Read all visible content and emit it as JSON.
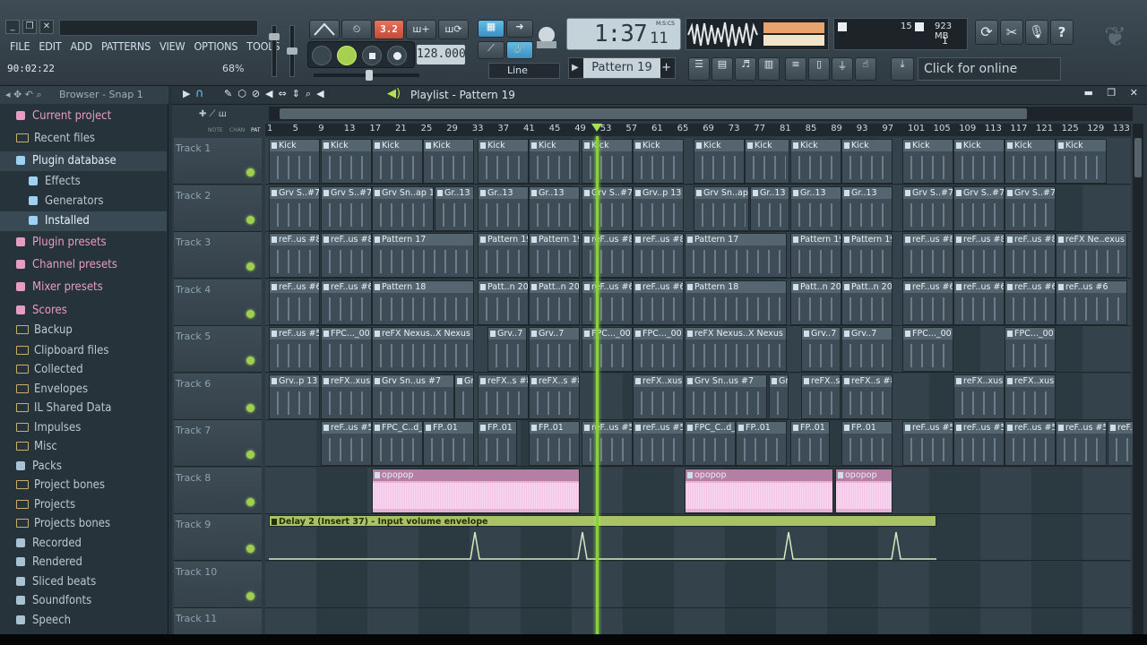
{
  "menu": [
    "FILE",
    "EDIT",
    "ADD",
    "PATTERNS",
    "VIEW",
    "OPTIONS",
    "TOOLS",
    "?"
  ],
  "status": {
    "time": "90:02:22",
    "zoom": "68%"
  },
  "toolbar": {
    "pattern_num": "3.2",
    "bpm": "128.000",
    "snap_mode": "Line",
    "song_time": "1:37",
    "song_time_small": "11",
    "song_time_unit": "M:S:CS",
    "pattern_name": "Pattern 19",
    "cpu_voices": "15",
    "memory": "923 MB",
    "cpu_count": "1",
    "online_news": "Click for online news"
  },
  "browser": {
    "header": "Browser - Snap 1",
    "items": [
      {
        "label": "Current project",
        "icon": "project-icon"
      },
      {
        "label": "Recent files",
        "icon": "folder-icon"
      },
      {
        "label": "Plugin database",
        "icon": "plugin-icon"
      },
      {
        "label": "Effects",
        "icon": "effect-icon"
      },
      {
        "label": "Generators",
        "icon": "generator-icon"
      },
      {
        "label": "Installed",
        "icon": "installed-icon"
      },
      {
        "label": "Plugin presets",
        "icon": "preset-icon"
      },
      {
        "label": "Channel presets",
        "icon": "preset-icon"
      },
      {
        "label": "Mixer presets",
        "icon": "mixer-icon"
      },
      {
        "label": "Scores",
        "icon": "note-icon"
      },
      {
        "label": "Backup",
        "icon": "folder-icon"
      },
      {
        "label": "Clipboard files",
        "icon": "folder-icon"
      },
      {
        "label": "Collected",
        "icon": "folder-icon"
      },
      {
        "label": "Envelopes",
        "icon": "folder-icon"
      },
      {
        "label": "IL Shared Data",
        "icon": "folder-icon"
      },
      {
        "label": "Impulses",
        "icon": "folder-icon"
      },
      {
        "label": "Misc",
        "icon": "folder-icon"
      },
      {
        "label": "Packs",
        "icon": "packs-icon"
      },
      {
        "label": "Project bones",
        "icon": "folder-icon"
      },
      {
        "label": "Projects",
        "icon": "folder-icon"
      },
      {
        "label": "Projects bones",
        "icon": "folder-icon"
      },
      {
        "label": "Recorded",
        "icon": "recorded-icon"
      },
      {
        "label": "Rendered",
        "icon": "rendered-icon"
      },
      {
        "label": "Sliced beats",
        "icon": "sliced-icon"
      },
      {
        "label": "Soundfonts",
        "icon": "soundfont-icon"
      },
      {
        "label": "Speech",
        "icon": "speech-icon"
      }
    ]
  },
  "playlist": {
    "title": "Playlist - Pattern 19",
    "header_labels": [
      "NOTE",
      "CHAN",
      "PAT"
    ],
    "ruler": [
      "1",
      "5",
      "9",
      "13",
      "17",
      "21",
      "25",
      "29",
      "33",
      "37",
      "41",
      "45",
      "49",
      "53",
      "57",
      "61",
      "65",
      "69",
      "73",
      "77",
      "81",
      "85",
      "89",
      "93",
      "97",
      "101",
      "105",
      "109",
      "113",
      "117",
      "121",
      "125",
      "129",
      "133"
    ],
    "tracks": [
      "Track 1",
      "Track 2",
      "Track 3",
      "Track 4",
      "Track 5",
      "Track 6",
      "Track 7",
      "Track 8",
      "Track 9",
      "Track 10",
      "Track 11"
    ],
    "clips": {
      "t1": [
        "Kick",
        "Kick",
        "Kick",
        "Kick",
        "Kick",
        "Kick",
        "Kick",
        "Kick",
        "Kick",
        "Kick",
        "Kick",
        "Kick",
        "Kick",
        "Kick",
        "Kick",
        "Kick"
      ],
      "t2": [
        "Grv S..#7",
        "Grv S..#7",
        "Grv Sn..ap 13",
        "Gr..13",
        "Gr..13",
        "Gr..13",
        "Grv S..#7",
        "Grv..p 13",
        "Grv Sn..ap 13",
        "Gr..13",
        "Gr..13",
        "Gr..13",
        "Grv S..#7",
        "Grv S..#7",
        "Grv S..#7"
      ],
      "t3": [
        "reF..us #8",
        "reF..us #8",
        "Pattern 17",
        "Pattern 19",
        "Pattern 19",
        "reF..us #8",
        "reF..us #8",
        "Pattern 17",
        "Pattern 19",
        "Pattern 19",
        "reF..us #8",
        "reF..us #8",
        "reF..us #8",
        "reFX Ne..exus #8"
      ],
      "t4": [
        "reF..us #6",
        "reF..us #6",
        "Pattern 18",
        "Patt..n 20",
        "Patt..n 20",
        "reF..us #6",
        "reF..us #6",
        "Pattern 18",
        "Patt..n 20",
        "Patt..n 20",
        "reF..us #6",
        "reF..us #6",
        "reF..us #6",
        "reF..us #6"
      ],
      "t5": [
        "reF..us #5",
        "FPC..._001",
        "reFX Nexus..X Nexus #8",
        "Grv..7",
        "Grv..7",
        "FPC..._001",
        "FPC..._001",
        "reFX Nexus..X Nexus #8",
        "Grv..7",
        "Grv..7",
        "FPC..._001",
        "FPC..._001"
      ],
      "t6": [
        "Grv..p 13",
        "reFX..xus",
        "Grv Sn..us #7",
        "Grv..7",
        "reFX..s #8",
        "reFX..s #8",
        "reFX..xus",
        "Grv Sn..us #7",
        "Grv..7",
        "reFX..s #8",
        "reFX..s #8",
        "reFX..xus",
        "reFX..xus"
      ],
      "t7": [
        "reF..us #5",
        "FPC_C..d_001",
        "FP..01",
        "FP..01",
        "FP..01",
        "reF..us #5",
        "reF..us #5",
        "FPC_C..d_001",
        "FP..01",
        "FP..01",
        "FP..01",
        "reF..us #5",
        "reF..us #5",
        "reF..us #5",
        "reF..us #5",
        "reF..us #5"
      ],
      "t8": [
        "opopop",
        "opopop",
        "opopop"
      ],
      "t9": [
        "Delay 2 (Insert 37) - Input volume envelope"
      ]
    }
  },
  "colors": {
    "accent": "#5fb8e4",
    "playhead": "#86d23b",
    "audio_clip": "#e6b3d7",
    "automation_clip": "#9cb55a",
    "track_led": "#9ed04d"
  }
}
